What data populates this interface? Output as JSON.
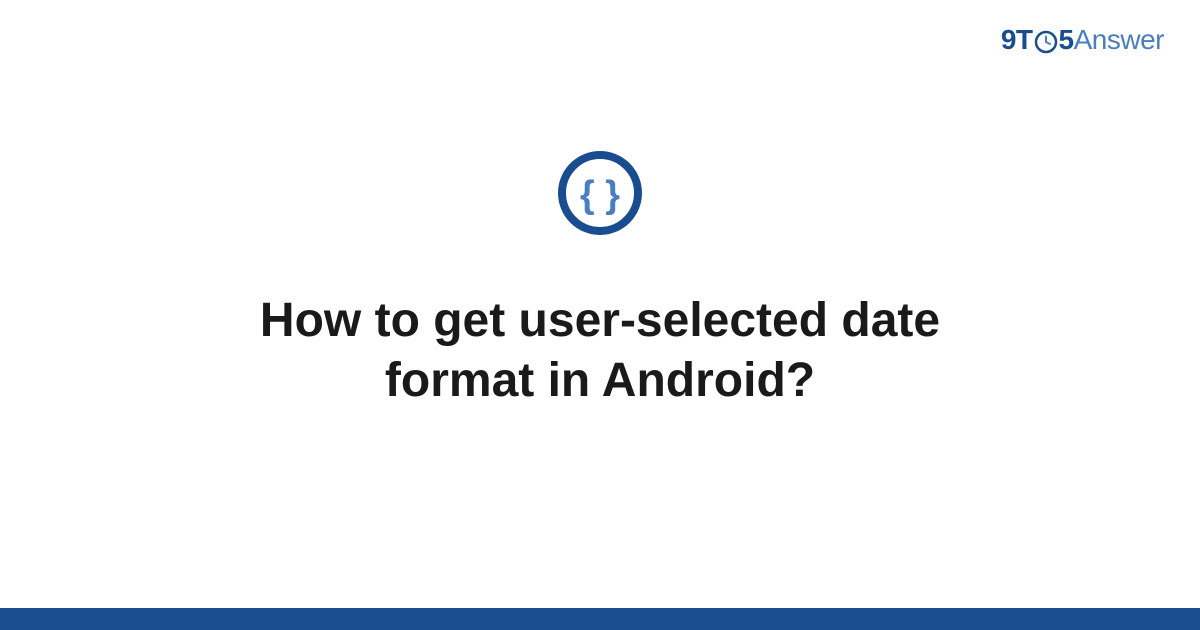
{
  "header": {
    "logo_9t": "9T",
    "logo_5": "5",
    "logo_answer": "Answer"
  },
  "main": {
    "question_title": "How to get user-selected date format in Android?"
  },
  "icons": {
    "code_braces": "code-braces-icon",
    "clock": "clock-icon"
  },
  "colors": {
    "primary_dark": "#1a4d8f",
    "primary_light": "#4a7ec2",
    "text_dark": "#1a1a1a"
  }
}
